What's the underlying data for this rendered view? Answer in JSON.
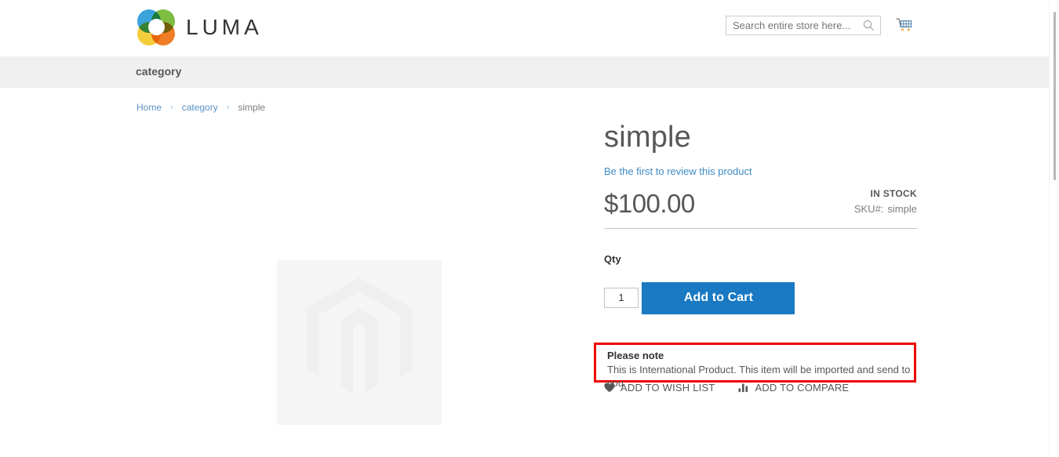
{
  "header": {
    "logo_text": "LUMA",
    "search": {
      "placeholder": "Search entire store here...",
      "value": ""
    }
  },
  "nav": {
    "items": [
      {
        "label": "category"
      }
    ]
  },
  "breadcrumb": {
    "items": [
      {
        "label": "Home",
        "is_link": true
      },
      {
        "label": "category",
        "is_link": true
      },
      {
        "label": "simple",
        "is_link": false
      }
    ],
    "separator": "›"
  },
  "product": {
    "title": "simple",
    "review_link": "Be the first to review this product",
    "price": "$100.00",
    "stock_status": "IN STOCK",
    "sku_label": "SKU#:",
    "sku_value": "simple",
    "qty_label": "Qty",
    "qty_value": "1",
    "add_to_cart_label": "Add to Cart",
    "note": {
      "title": "Please note",
      "text": "This is International Product. This item will be imported and send to you"
    },
    "wishlist_label": "ADD TO WISH LIST",
    "compare_label": "ADD TO COMPARE"
  },
  "colors": {
    "accent_blue": "#1979c3",
    "link_blue": "#3e8bc4",
    "nav_band": "#f0f0f0",
    "highlight_red": "#ee0000",
    "text_dark": "#575757",
    "image_placeholder": "#f5f5f5"
  }
}
